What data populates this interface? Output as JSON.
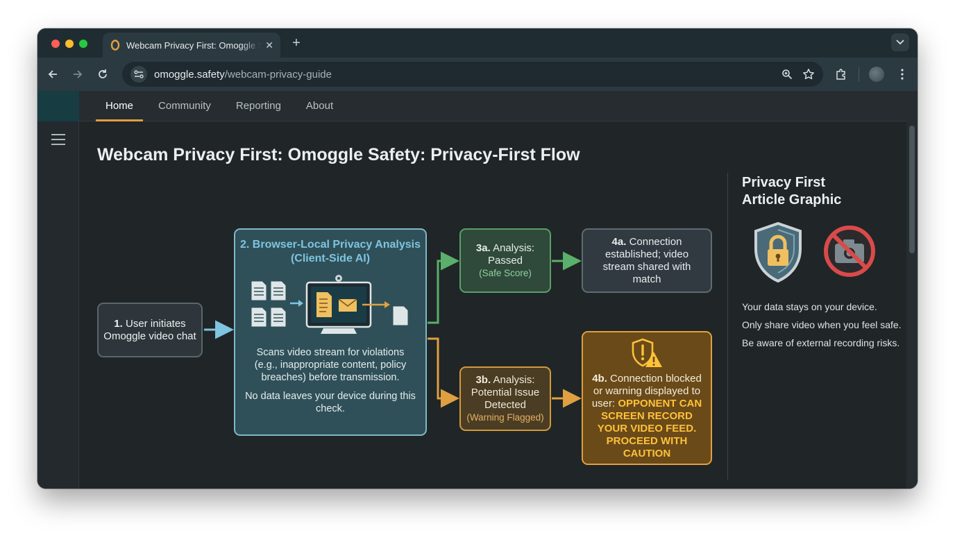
{
  "browser": {
    "tab_title": "Webcam Privacy First: Omoggle Safety",
    "url_host": "omoggle.safety",
    "url_path": "/webcam-privacy-guide"
  },
  "nav": {
    "tabs": [
      "Home",
      "Community",
      "Reporting",
      "About"
    ],
    "active": "Home"
  },
  "page": {
    "title": "Webcam Privacy First: Omoggle Safety: Privacy-First Flow"
  },
  "flow": {
    "step1": {
      "num": "1.",
      "text": "User initiates Omoggle video chat"
    },
    "step2": {
      "heading": "2. Browser-Local Privacy Analysis (Client-Side AI)",
      "desc": "Scans video stream for violations (e.g., inappropriate content, policy breaches) before transmission.",
      "desc2": "No data leaves your device during this check."
    },
    "step3a": {
      "num": "3a.",
      "title": "Analysis: Passed",
      "sub": "(Safe Score)"
    },
    "step4a": {
      "num": "4a.",
      "text": "Connection established; video stream shared with match"
    },
    "step3b": {
      "num": "3b.",
      "title": "Analysis: Potential Issue Detected",
      "sub": "(Warning Flagged)"
    },
    "step4b": {
      "num": "4b.",
      "text": "Connection blocked or warning displayed to user:",
      "warning": "OPPONENT CAN SCREEN RECORD YOUR VIDEO FEED. PROCEED WITH CAUTION"
    }
  },
  "side_panel": {
    "title": "Privacy First Article Graphic",
    "lines": [
      "Your data stays on your device.",
      "Only share video when you feel safe.",
      "Be aware of external recording risks."
    ]
  },
  "colors": {
    "accent_orange": "#e0a040",
    "pass_green": "#5aa06a",
    "analysis_blue": "#7fc4e0",
    "warning_yellow": "#ffc13a"
  }
}
